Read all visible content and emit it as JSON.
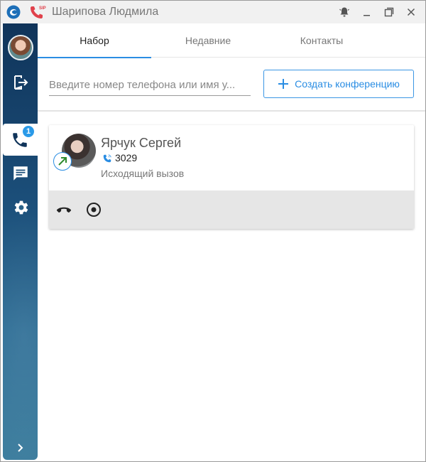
{
  "window": {
    "title": "Шарипова Людмила",
    "sip_label": "SIP"
  },
  "tabs": [
    {
      "label": "Набор",
      "active": true
    },
    {
      "label": "Недавние",
      "active": false
    },
    {
      "label": "Контакты",
      "active": false
    }
  ],
  "sidebar": {
    "badge_count": "1",
    "items": [
      "avatar",
      "logout-icon",
      "phone-icon",
      "chat-icon",
      "gear-icon",
      "chevron-right-icon"
    ]
  },
  "search": {
    "placeholder": "Введите номер телефона или имя у...",
    "value": ""
  },
  "conference_button": {
    "label": "Создать конференцию"
  },
  "call": {
    "name": "Ярчук Сергей",
    "extension": "3029",
    "status": "Исходящий вызов",
    "direction": "outgoing"
  },
  "colors": {
    "accent": "#2a8de3",
    "sidebar_top": "#10345a",
    "sidebar_bottom": "#3f7f9f",
    "sip_red": "#e0414b",
    "outgoing_arrow": "#2e8b2e"
  }
}
